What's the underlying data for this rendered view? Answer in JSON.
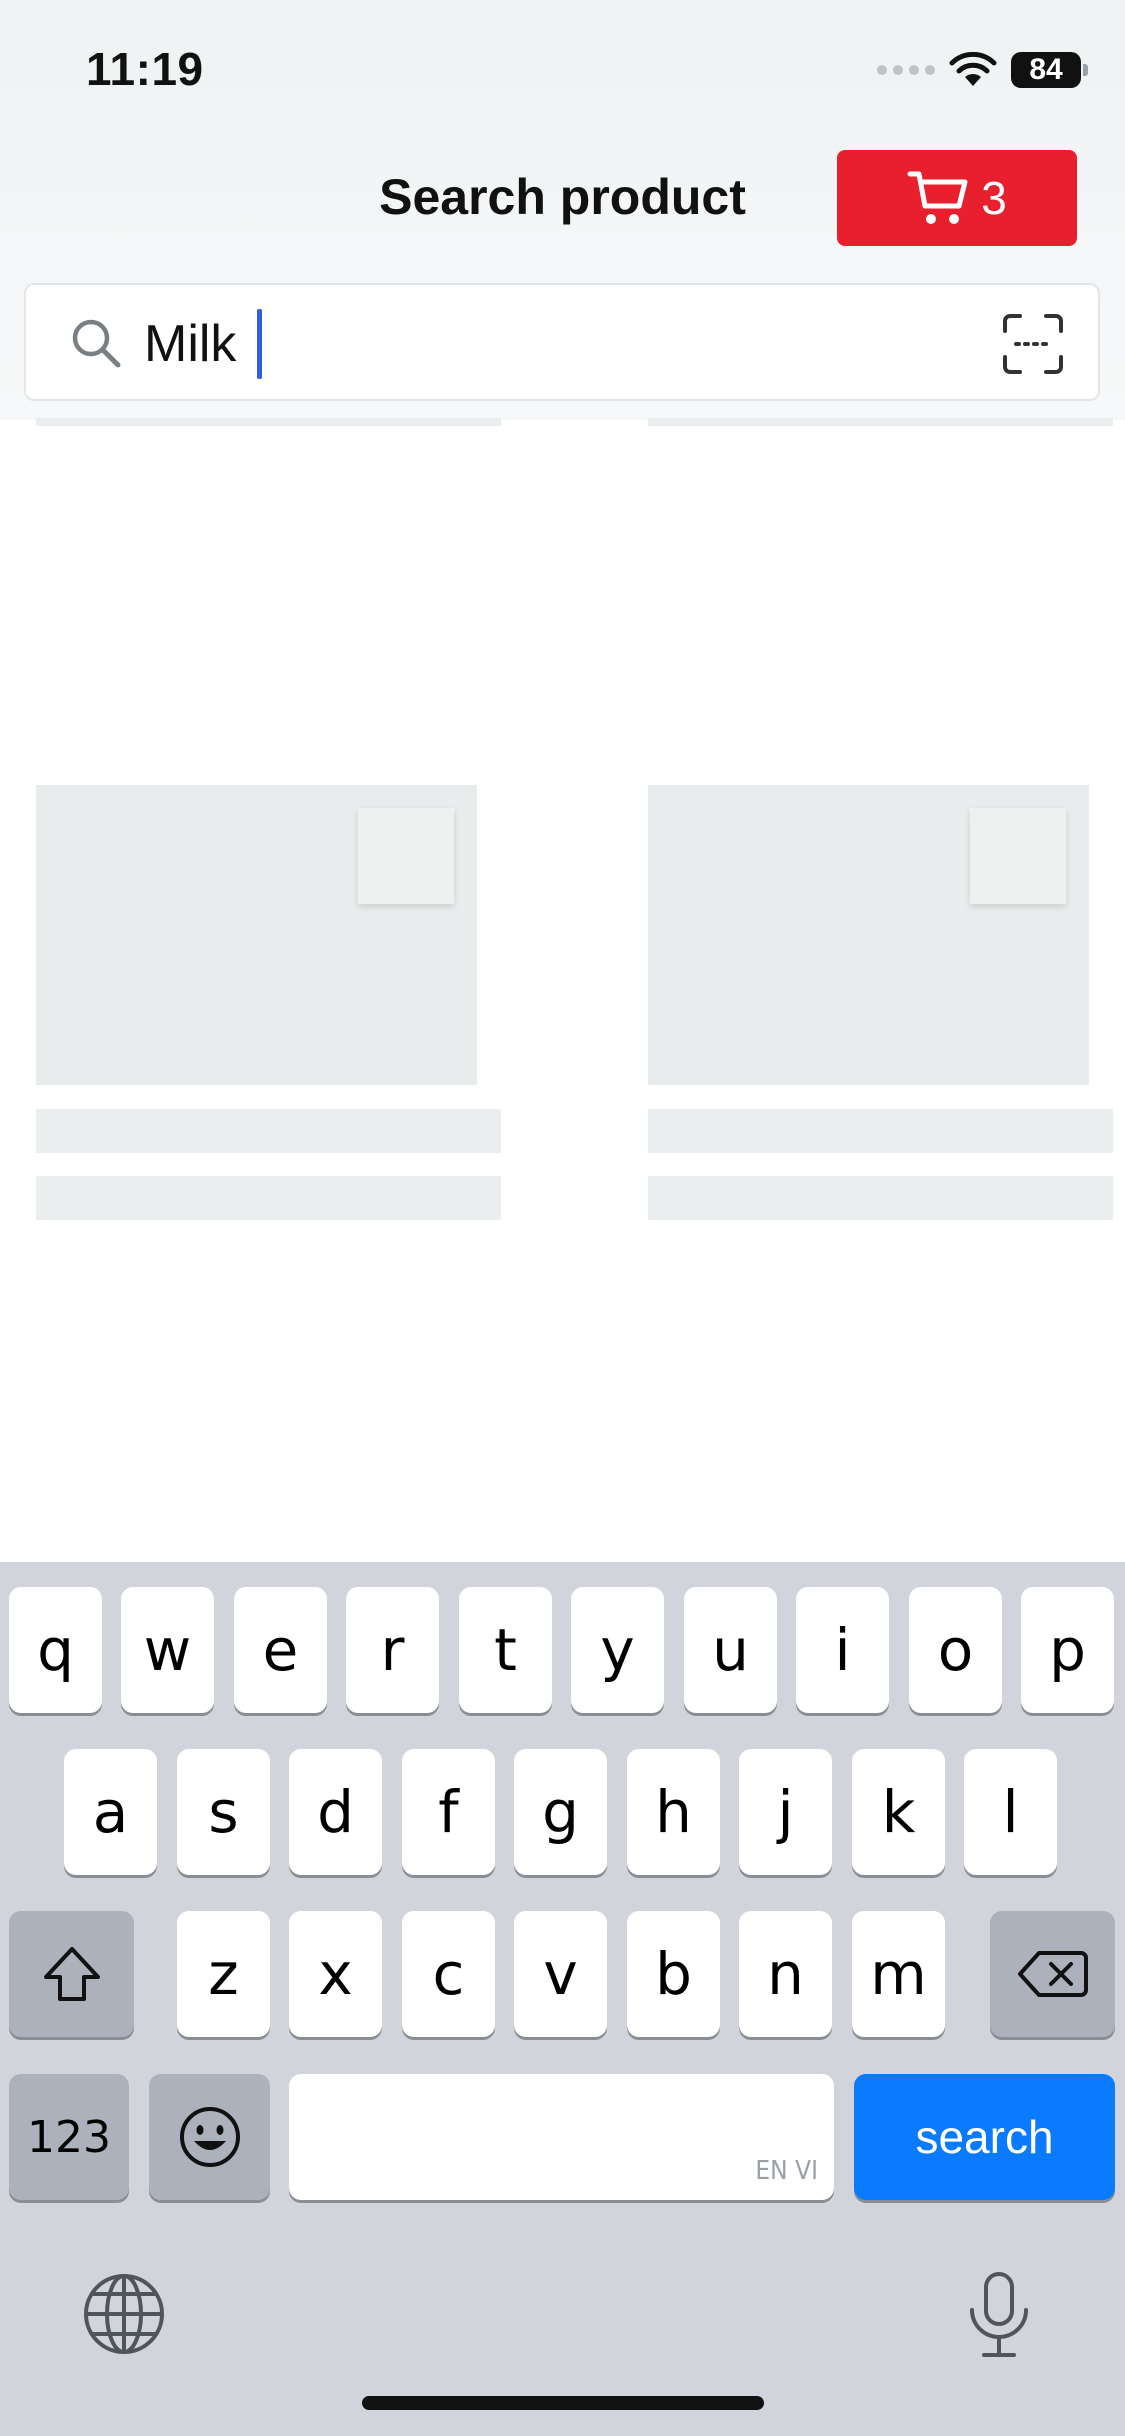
{
  "status_bar": {
    "time": "11:19",
    "battery": "84"
  },
  "header": {
    "title": "Search product",
    "cart_count": "3"
  },
  "search": {
    "value": "Milk"
  },
  "keyboard": {
    "row1": [
      "q",
      "w",
      "e",
      "r",
      "t",
      "y",
      "u",
      "i",
      "o",
      "p"
    ],
    "row2": [
      "a",
      "s",
      "d",
      "f",
      "g",
      "h",
      "j",
      "k",
      "l"
    ],
    "row3": [
      "z",
      "x",
      "c",
      "v",
      "b",
      "n",
      "m"
    ],
    "numbers_label": "123",
    "space_label": "EN VI",
    "search_label": "search"
  },
  "colors": {
    "accent_red": "#e8202e",
    "key_blue": "#0a7aff",
    "caret": "#2f5fe0"
  }
}
